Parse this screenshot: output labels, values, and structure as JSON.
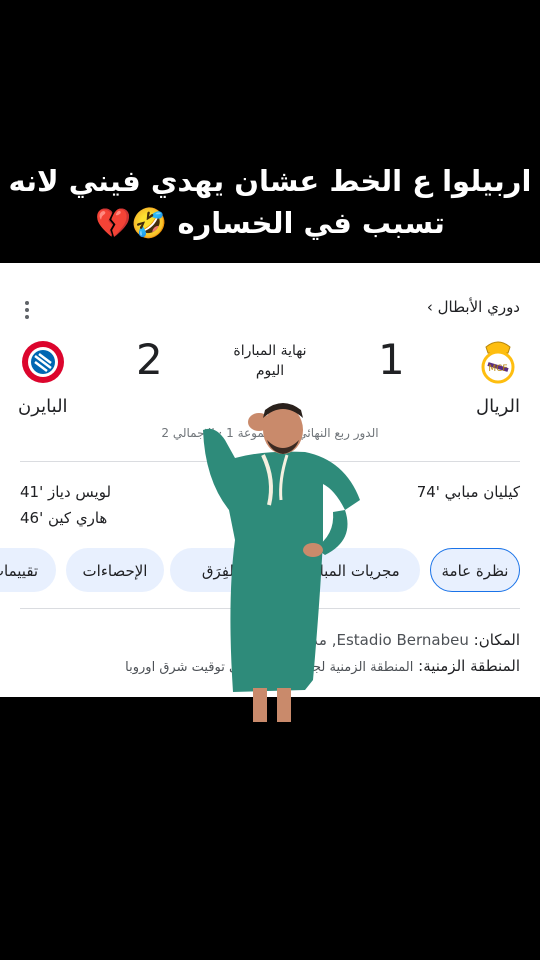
{
  "caption": {
    "line1": "اربيلوا ع الخط  عشان يهدي فيني لانه",
    "line2": "تسبب في الخساره 🤣💔"
  },
  "card": {
    "league": "دوري الأبطال ›",
    "home_team": "الريال",
    "away_team": "البايرن",
    "home_score": "1",
    "away_score": "2",
    "status_line1": "نهاية المباراة",
    "status_line2": "اليوم",
    "round": "الدور ربع النهائي · المجموعة 1 · الإجمالي 2",
    "home_scorers": [
      "كيليان مبابي '74"
    ],
    "away_scorers": [
      "لويس دياز '41",
      "هاري كين '46"
    ],
    "tabs": [
      "نظرة عامة",
      "مجريات المباراة",
      "الفِرَق",
      "الإحصاءات",
      "تقييمات"
    ],
    "venue_label": "المكان:",
    "venue_value": "Estadio Bernabeu, مدريد",
    "timezone_label": "المنطقة الزمنية:",
    "timezone_value": "المنطقة الزمنية لجميع الأوقات هي توقيت شرق اوروبا"
  },
  "colors": {
    "tab_bg": "#e8f0fe",
    "tab_active_border": "#1a73e8",
    "bayern_red": "#dc052d",
    "madrid_gold": "#febe10",
    "robe_green": "#2e8b7a"
  }
}
